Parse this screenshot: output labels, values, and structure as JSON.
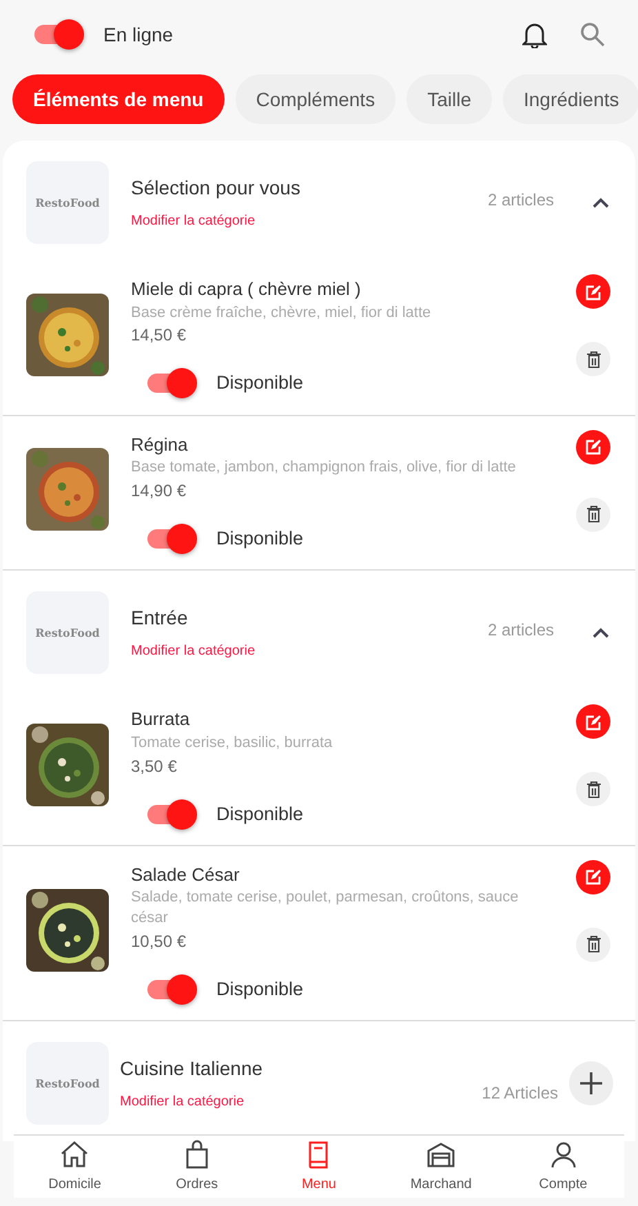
{
  "header": {
    "status": {
      "label": "En ligne",
      "on": true
    }
  },
  "tabs": [
    {
      "label": "Éléments de menu",
      "selected": true
    },
    {
      "label": "Compléments",
      "selected": false
    },
    {
      "label": "Taille",
      "selected": false
    },
    {
      "label": "Ingrédients",
      "selected": false
    }
  ],
  "categories": [
    {
      "logo": "RestoFood",
      "name": "Sélection pour vous",
      "edit_label": "Modifier la catégorie",
      "count": "2 articles",
      "expanded": true,
      "items": [
        {
          "name": "Miele di capra ( chèvre miel )",
          "description": "Base crème fraîche, chèvre, miel, fior di latte",
          "price": "14,50 €",
          "available": true,
          "available_label": "Disponible"
        },
        {
          "name": "Régina",
          "description": "Base tomate, jambon, champignon frais, olive, fior di latte",
          "price": "14,90 €",
          "available": true,
          "available_label": "Disponible"
        }
      ]
    },
    {
      "logo": "RestoFood",
      "name": "Entrée",
      "edit_label": "Modifier la catégorie",
      "count": "2 articles",
      "expanded": true,
      "items": [
        {
          "name": "Burrata",
          "description": "Tomate cerise, basilic, burrata",
          "price": "3,50 €",
          "available": true,
          "available_label": "Disponible"
        },
        {
          "name": "Salade César",
          "description": "Salade, tomate cerise, poulet, parmesan, croûtons, sauce césar",
          "price": "10,50 €",
          "available": true,
          "available_label": "Disponible"
        }
      ]
    },
    {
      "logo": "RestoFood",
      "name": "Cuisine Italienne",
      "edit_label": "Modifier la catégorie",
      "count": "12 Articles",
      "expanded": false
    }
  ],
  "bottom_nav": [
    {
      "label": "Domicile",
      "selected": false
    },
    {
      "label": "Ordres",
      "selected": false
    },
    {
      "label": "Menu",
      "selected": true
    },
    {
      "label": "Marchand",
      "selected": false
    },
    {
      "label": "Compte",
      "selected": false
    }
  ]
}
